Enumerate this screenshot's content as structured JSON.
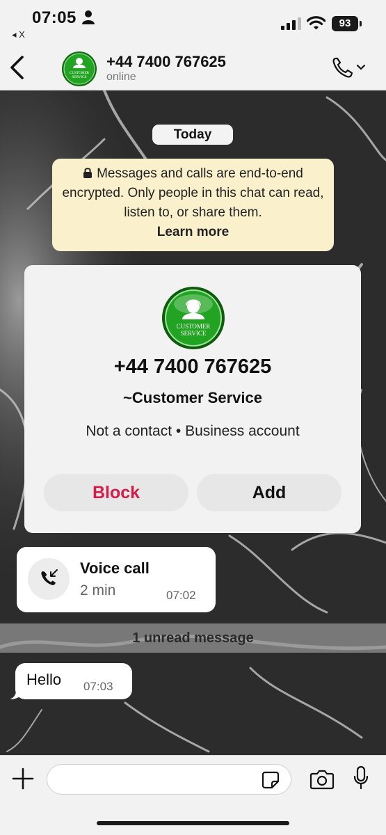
{
  "status_bar": {
    "time": "07:05",
    "back_app": "◂ X",
    "battery": "93"
  },
  "chat_header": {
    "name": "+44 7400 767625",
    "status": "online",
    "avatar_text_line1": "CUSTOMER",
    "avatar_text_line2": "SERVICE"
  },
  "conversation": {
    "date_label": "Today",
    "encryption_notice": "Messages and calls are end-to-end encrypted. Only people in this chat can read, listen to, or share them.",
    "encryption_link": "Learn more"
  },
  "contact_card": {
    "phone": "+44 7400 767625",
    "name": "~Customer Service",
    "meta": "Not a contact • Business account",
    "block_label": "Block",
    "add_label": "Add",
    "avatar_text_line1": "CUSTOMER",
    "avatar_text_line2": "SERVICE"
  },
  "voice_call": {
    "title": "Voice call",
    "duration": "2 min",
    "time": "07:02"
  },
  "unread_divider": "1 unread message",
  "messages": [
    {
      "text": "Hello",
      "time": "07:03"
    }
  ],
  "composer": {
    "placeholder": ""
  },
  "colors": {
    "block_red": "#d41c4a",
    "notice_bg": "#fbf0cc",
    "avatar_green": "#1e9a1e"
  }
}
